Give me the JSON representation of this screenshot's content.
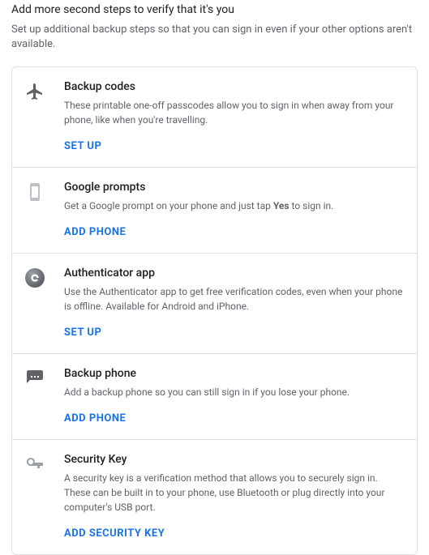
{
  "header": {
    "title": "Add more second steps to verify that it's you",
    "subtitle": "Set up additional backup steps so that you can sign in even if your other options aren't available."
  },
  "items": [
    {
      "id": "backup-codes",
      "icon": "plane-icon",
      "title": "Backup codes",
      "desc": "These printable one-off passcodes allow you to sign in when away from your phone, like when you're travelling.",
      "action": "Set up"
    },
    {
      "id": "google-prompts",
      "icon": "phone-icon",
      "title": "Google prompts",
      "desc_pre": "Get a Google prompt on your phone and just tap ",
      "desc_bold": "Yes",
      "desc_post": " to sign in.",
      "action": "Add phone"
    },
    {
      "id": "authenticator-app",
      "icon": "authenticator-icon",
      "title": "Authenticator app",
      "desc": "Use the Authenticator app to get free verification codes, even when your phone is offline. Available for Android and iPhone.",
      "action": "Set up"
    },
    {
      "id": "backup-phone",
      "icon": "sms-icon",
      "title": "Backup phone",
      "desc": "Add a backup phone so you can still sign in if you lose your phone.",
      "action": "Add phone"
    },
    {
      "id": "security-key",
      "icon": "key-icon",
      "title": "Security Key",
      "desc": "A security key is a verification method that allows you to securely sign in. These can be built in to your phone, use Bluetooth or plug directly into your computer's USB port.",
      "action": "Add security key"
    }
  ]
}
